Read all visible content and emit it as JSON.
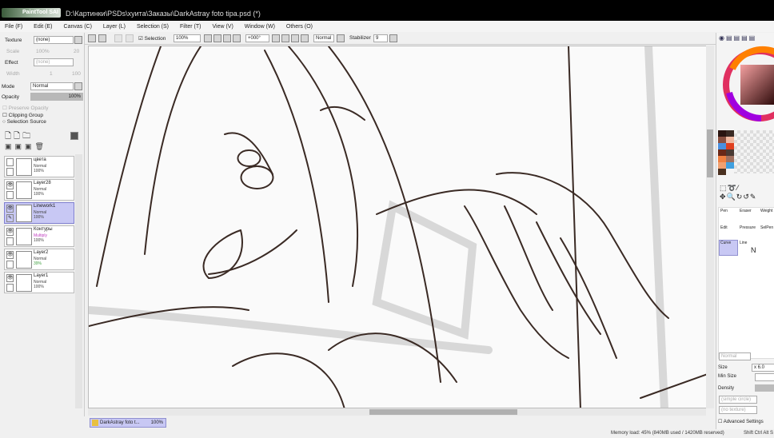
{
  "title": {
    "app": "PaintTool SAI",
    "path": "D:\\Картинки\\PSDs\\хуита\\Заказы\\DarkAstray foto tipa.psd (*)"
  },
  "menu": [
    "File (F)",
    "Edit (E)",
    "Canvas (C)",
    "Layer (L)",
    "Selection (S)",
    "Filter (T)",
    "View (V)",
    "Window (W)",
    "Others (O)"
  ],
  "toolbar": {
    "selection_label": "Selection",
    "zoom": "100%",
    "rotation": "+000°",
    "blend": "Normal",
    "stabilizer_label": "Stabilizer",
    "stabilizer": "9"
  },
  "left": {
    "texture_label": "Texture",
    "texture": "(none)",
    "scale_label": "Scale",
    "scale": "100%",
    "scale_n": "20",
    "effect_label": "Effect",
    "effect": "(none)",
    "width_label": "Width",
    "width": "1",
    "width_n": "100",
    "mode_label": "Mode",
    "mode": "Normal",
    "opacity_label": "Opacity",
    "opacity": "100%",
    "preserve": "Preserve Opacity",
    "clipping": "Clipping Group",
    "selsource": "Selection Source"
  },
  "layers": [
    {
      "name": "цвета",
      "mode": "Normal",
      "opacity": "100%",
      "visible": false,
      "selected": false
    },
    {
      "name": "Layer28",
      "mode": "Normal",
      "opacity": "100%",
      "visible": true,
      "selected": false
    },
    {
      "name": "Linework1",
      "mode": "Normal",
      "opacity": "100%",
      "visible": true,
      "selected": true
    },
    {
      "name": "Контуры",
      "mode": "Multiply",
      "opacity": "100%",
      "visible": true,
      "selected": false
    },
    {
      "name": "Layer2",
      "mode": "Normal",
      "opacity": "39%",
      "visible": true,
      "selected": false
    },
    {
      "name": "Layer1",
      "mode": "Normal",
      "opacity": "100%",
      "visible": true,
      "selected": false
    }
  ],
  "tools": {
    "pen": "Pen",
    "eraser": "Eraser",
    "weight": "Weight",
    "edit": "Edit",
    "pressure": "Pressure",
    "selpen": "SelPen",
    "curve": "Curve",
    "line": "Line"
  },
  "brush": {
    "mode": "Normal",
    "size_label": "Size",
    "size": "x 6.0",
    "minsize_label": "Min Size",
    "density_label": "Density",
    "shape": "(simple circle)",
    "texture": "(no texture)",
    "advanced": "Advanced Settings"
  },
  "swatches": [
    "#2a1410",
    "#3a2a24",
    "#8a5040",
    "#f0b8a0",
    "#4a90e0",
    "#e04020",
    "#6a2818",
    "#4a3a34",
    "#f08040",
    "#a07060",
    "#f0a070",
    "#40a0e0",
    "#4a3020"
  ],
  "doc_tab": {
    "name": "DarkAstray foto t...",
    "zoom": "100%"
  },
  "status": {
    "memory": "Memory load: 45% (840MB used / 1420MB reserved)",
    "keys": "Shift Ctrl Alt S"
  }
}
